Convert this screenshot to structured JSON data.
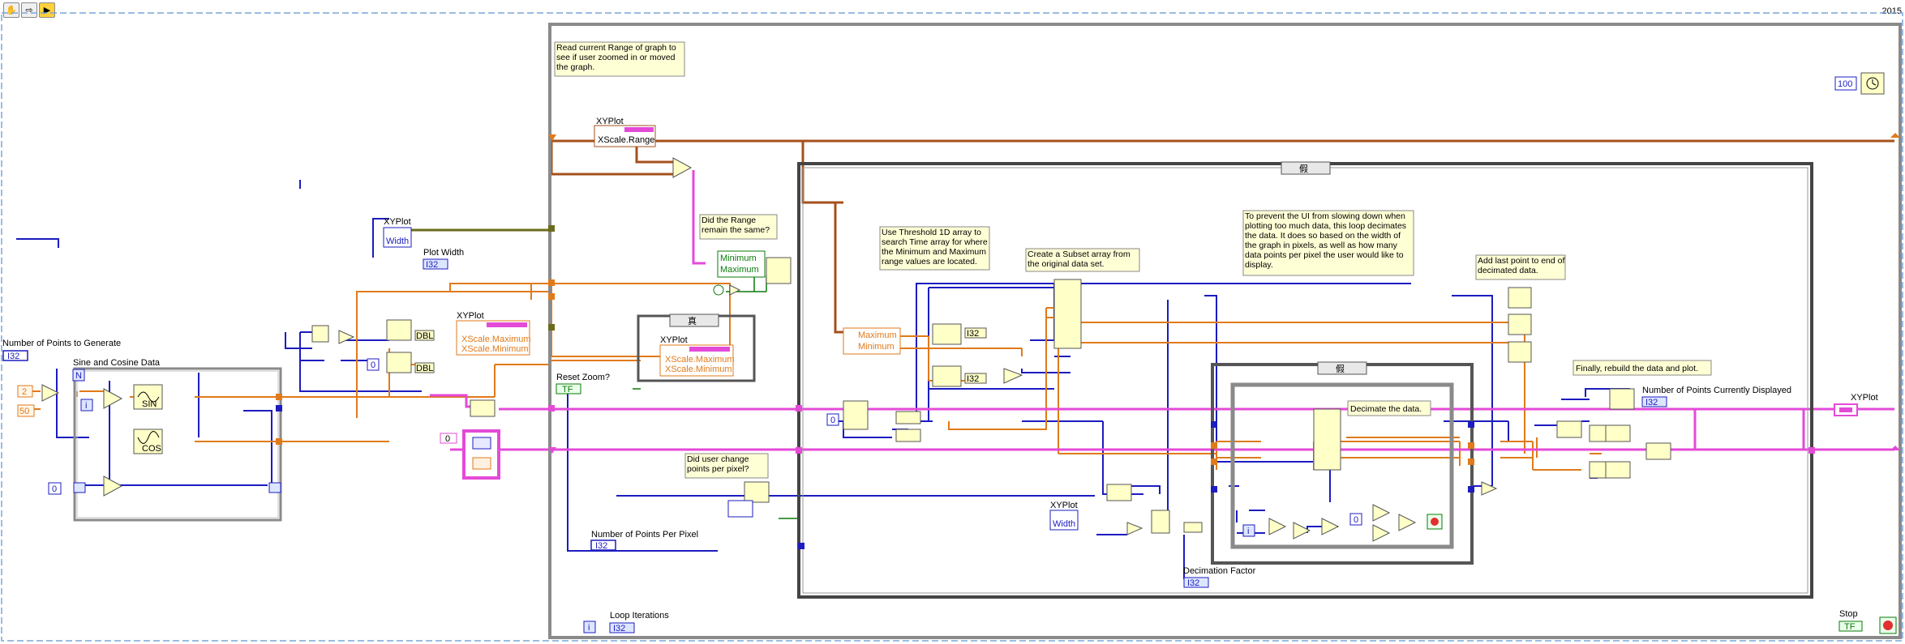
{
  "toolbar": {
    "highlight_icon": "hand-icon",
    "step_icon": "arrow-icon",
    "run_icon": "run-arrow-icon"
  },
  "version": "2015",
  "labels": {
    "num_points_generate": "Number of Points to Generate",
    "sine_cosine": "Sine and Cosine Data",
    "xyplot": "XYPlot",
    "width": "Width",
    "plot_width": "Plot Width",
    "xscale_range": "XScale.Range",
    "xscale_maximum": "XScale.Maximum",
    "xscale_minimum": "XScale.Minimum",
    "reset_zoom": "Reset Zoom?",
    "true_case": "真",
    "false_case": "假",
    "maximum": "Maximum",
    "minimum": "Minimum",
    "number_points_per_pixel": "Number of Points Per Pixel",
    "loop_iterations": "Loop Iterations",
    "decimation_factor": "Decimation Factor",
    "number_points_displayed": "Number of Points Currently Displayed",
    "stop": "Stop"
  },
  "notes": {
    "read_range": "Read current Range of graph to see if user zoomed in or moved the graph.",
    "did_range": "Did the Range remain the same?",
    "did_user_change": "Did user change points per pixel?",
    "use_threshold": "Use Threshold 1D array to search Time array for where the Minimum and Maximum range values are located.",
    "create_subset": "Create a Subset array from the original data set.",
    "prevent_ui": "To prevent the UI from slowing down when plotting too much data, this loop decimates the data. It does so based on the width of the graph in pixels, as well as how many data points per pixel the user would like to display.",
    "add_last": "Add last point to end of decimated data.",
    "decimate": "Decimate the data.",
    "finally": "Finally, rebuild the data and plot."
  },
  "constants": {
    "n": "N",
    "i": "i",
    "k2": "2",
    "k50": "50",
    "k0a": "0",
    "k0b": "0",
    "k0c": "0",
    "k0d": "0",
    "k0e": "0",
    "k100": "100",
    "tf": "TF",
    "i32": "I32",
    "dbl": "DBL",
    "sin": "SIN",
    "cos": "COS"
  },
  "colors": {
    "blue": "#1c1cc0",
    "orange": "#e07a1a",
    "pink": "#e44ad8",
    "brown": "#a5501c",
    "green": "#0a7a0a",
    "olive": "#6b6b1e",
    "frame": "#8a8a8a"
  }
}
